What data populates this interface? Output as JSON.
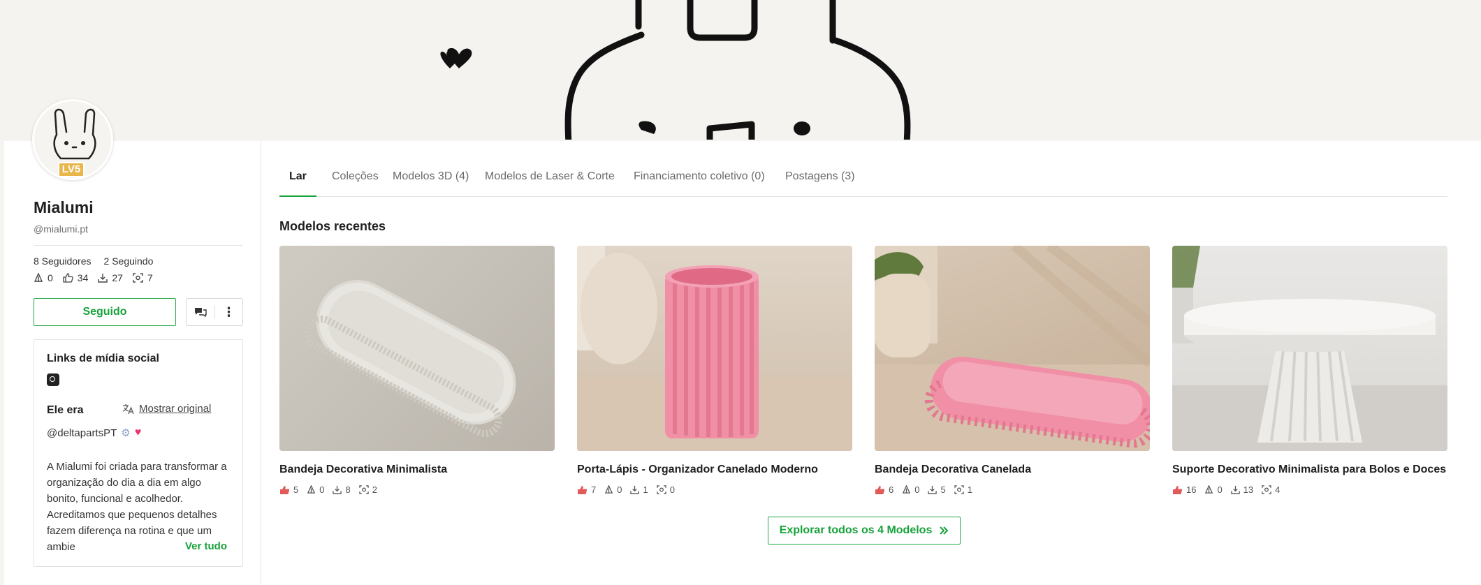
{
  "profile": {
    "name": "Mialumi",
    "handle": "@mialumi.pt",
    "level": "LV5",
    "followers": "8 Seguidores",
    "following": "2 Seguindo",
    "stats": {
      "boosts": "0",
      "likes": "34",
      "downloads": "27",
      "prints": "7"
    },
    "follow_button": "Seguido"
  },
  "info_card": {
    "social_title": "Links de mídia social",
    "about_title": "Ele era",
    "translate_label": "Mostrar original",
    "handle_line": "@deltapartsPT",
    "bio": "A Mialumi foi criada para transformar a organização do dia a dia em algo bonito, funcional e acolhedor. Acreditamos que pequenos detalhes fazem diferença na rotina e que um ambie",
    "see_all": "Ver tudo"
  },
  "tabs": [
    {
      "label": "Lar"
    },
    {
      "label": "Coleções"
    },
    {
      "label": "Modelos 3D (4)"
    },
    {
      "label": "Modelos de Laser & Corte"
    },
    {
      "label": "Financiamento coletivo (0)"
    },
    {
      "label": "Postagens (3)"
    }
  ],
  "section_title": "Modelos recentes",
  "models": [
    {
      "title": "Bandeja Decorativa Minimalista",
      "likes": "5",
      "boosts": "0",
      "downloads": "8",
      "prints": "2"
    },
    {
      "title": "Porta-Lápis - Organizador Canelado Moderno",
      "likes": "7",
      "boosts": "0",
      "downloads": "1",
      "prints": "0"
    },
    {
      "title": "Bandeja Decorativa Canelada",
      "likes": "6",
      "boosts": "0",
      "downloads": "5",
      "prints": "1"
    },
    {
      "title": "Suporte Decorativo Minimalista para Bolos e Doces",
      "likes": "16",
      "boosts": "0",
      "downloads": "13",
      "prints": "4"
    }
  ],
  "explore_button": "Explorar todos os 4 Modelos",
  "colors": {
    "accent": "#18a23b",
    "like": "#e05a5a",
    "level_badge": "#e9b64a"
  }
}
